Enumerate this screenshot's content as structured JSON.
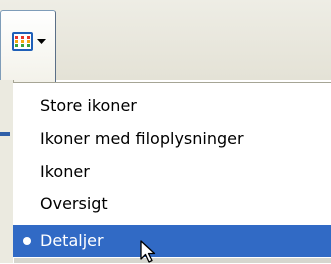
{
  "toolbar": {
    "view_button_icon": "details-view-icon",
    "dropdown_icon": "dropdown-arrow-icon"
  },
  "menu": {
    "items": [
      {
        "label": "Store ikoner",
        "selected": false
      },
      {
        "label": "Ikoner med filoplysninger",
        "selected": false
      },
      {
        "label": "Ikoner",
        "selected": false
      },
      {
        "label": "Oversigt",
        "selected": false
      },
      {
        "label": "Detaljer",
        "selected": true
      }
    ]
  },
  "colors": {
    "selection": "#316ac5",
    "icon_blue": "#1f5fb8",
    "toolbar_bg": "#ece9d8"
  },
  "cursor": {
    "icon": "arrow-cursor-icon"
  }
}
